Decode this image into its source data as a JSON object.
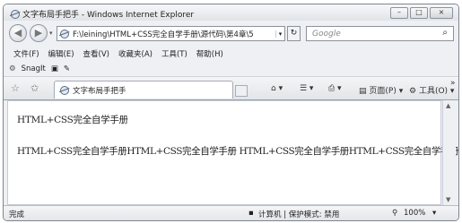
{
  "window": {
    "title": "文字布局手把手 - Windows Internet Explorer",
    "buttons": {
      "minimize": "–",
      "maximize": "□",
      "close": "×"
    }
  },
  "nav": {
    "back_icon": "back-arrow-icon",
    "forward_icon": "forward-arrow-icon",
    "address": "F:\\leining\\HTML+CSS完全自学手册\\源代码\\第4章\\5",
    "address_dropdown": "▾",
    "refresh": "↻",
    "stop": "✕",
    "search_placeholder": "Google",
    "search_icon": "⌕"
  },
  "menu": [
    "文件(F)",
    "编辑(E)",
    "查看(V)",
    "收藏夹(A)",
    "工具(T)",
    "帮助(H)"
  ],
  "links": {
    "snagit": "SnagIt"
  },
  "tabbar": {
    "tab_label": "文字布局手把手",
    "commands": {
      "page": "页面(P)",
      "tools": "工具(O)",
      "more": "»"
    }
  },
  "content": {
    "line1": "HTML+CSS完全自学手册",
    "line2": "HTML+CSS完全自学手册HTML+CSS完全自学手册 HTML+CSS完全自学手册HTML+CSS完全自学手册"
  },
  "status": {
    "left": "完成",
    "zone": "计算机 | 保护模式: 禁用",
    "zoom": "100%"
  }
}
